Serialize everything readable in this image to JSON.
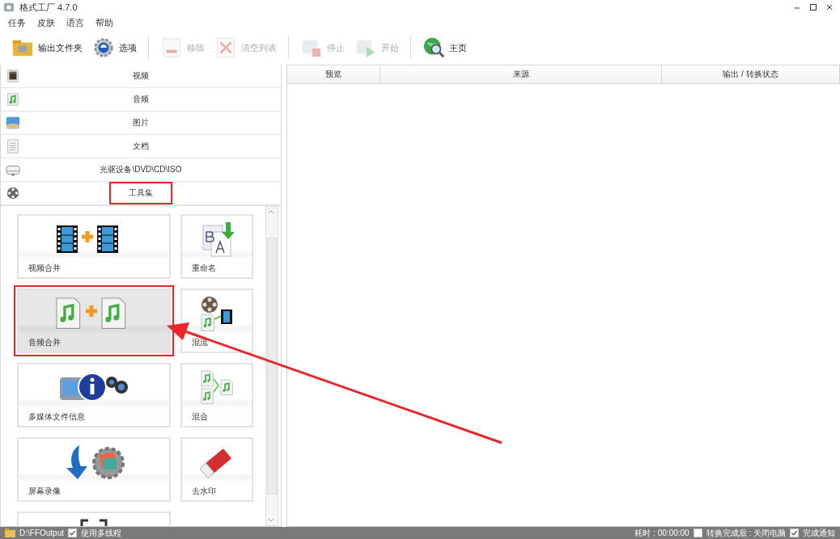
{
  "window": {
    "title": "格式工厂 4.7.0"
  },
  "menu": [
    "任务",
    "皮肤",
    "语言",
    "帮助"
  ],
  "toolbar": [
    {
      "label": "输出文件夹",
      "disabled": false
    },
    {
      "label": "选项",
      "disabled": false
    },
    {
      "label": "移除",
      "disabled": true
    },
    {
      "label": "清空列表",
      "disabled": true
    },
    {
      "label": "停止",
      "disabled": true
    },
    {
      "label": "开始",
      "disabled": true
    },
    {
      "label": "主页",
      "disabled": false
    }
  ],
  "categories": [
    {
      "label": "视频",
      "expanded": false
    },
    {
      "label": "音频",
      "expanded": false
    },
    {
      "label": "图片",
      "expanded": false
    },
    {
      "label": "文档",
      "expanded": false
    },
    {
      "label": "光驱设备\\DVD\\CD\\ISO",
      "expanded": false
    },
    {
      "label": "工具集",
      "expanded": true
    }
  ],
  "tools": [
    {
      "label": "视频合并",
      "selected": false
    },
    {
      "label": "重命名",
      "selected": false
    },
    {
      "label": "音频合并",
      "selected": true
    },
    {
      "label": "混流",
      "selected": false
    },
    {
      "label": "多媒体文件信息",
      "selected": false
    },
    {
      "label": "混合",
      "selected": false
    },
    {
      "label": "屏幕录像",
      "selected": false
    },
    {
      "label": "去水印",
      "selected": false
    },
    {
      "selected": false
    }
  ],
  "table": {
    "columns": [
      "预览",
      "来源",
      "输出 / 转换状态"
    ]
  },
  "status_bar": {
    "output_folder": "D:\\FFOutput",
    "multithread": {
      "label": "使用多线程",
      "checked": true
    },
    "elapsed": "耗时 : 00:00:00",
    "shutdown": {
      "label": "转换完成后 : 关闭电脑",
      "checked": false
    },
    "notify": {
      "label": "完成通知",
      "checked": true
    }
  }
}
